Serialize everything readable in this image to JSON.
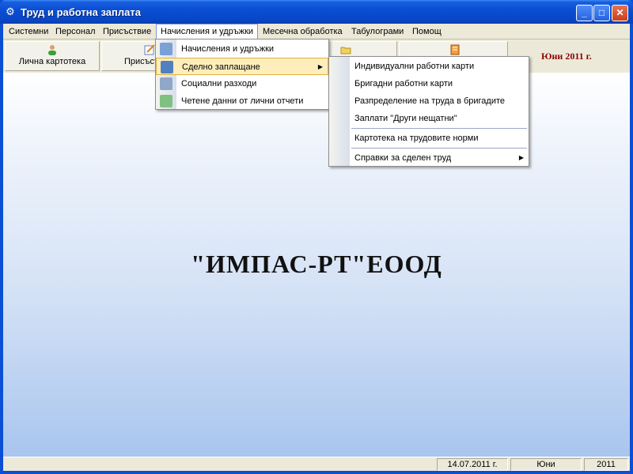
{
  "window": {
    "title": "Труд и работна заплата",
    "icon": "gear-icon"
  },
  "menubar": [
    "Системни",
    "Персонал",
    "Присъствие",
    "Начисления и удръжки",
    "Месечна обработка",
    "Табулограми",
    "Помощ"
  ],
  "toolbar": {
    "buttons": [
      {
        "label": "Лична картотека",
        "icon": "person-icon"
      },
      {
        "label": "Присъст",
        "icon": "notepad-icon"
      },
      {
        "label": "",
        "icon": "folder-icon"
      },
      {
        "label": "",
        "icon": "book-icon"
      }
    ],
    "period": "Юни 2011 г."
  },
  "main": {
    "company": "\"ИМПАС-РТ\"ЕООД"
  },
  "statusbar": {
    "date": "14.07.2011 г.",
    "month": "Юни",
    "year": "2011"
  },
  "menu_charges": {
    "items": [
      {
        "label": "Начисления и удръжки",
        "icon": "calculator-icon"
      },
      {
        "label": "Сделно заплащане",
        "icon": "worker-icon",
        "submenu": true
      },
      {
        "label": "Социални разходи",
        "icon": "people-icon"
      },
      {
        "label": "Четене данни от лични отчети",
        "icon": "report-icon"
      }
    ]
  },
  "menu_piecework": {
    "items": [
      "Индивидуални работни карти",
      "Бригадни работни карти",
      "Разпределение на труда в бригадите",
      "Заплати \"Други нещатни\"",
      "Картотека на трудовите норми",
      "Справки за сделен труд"
    ]
  }
}
